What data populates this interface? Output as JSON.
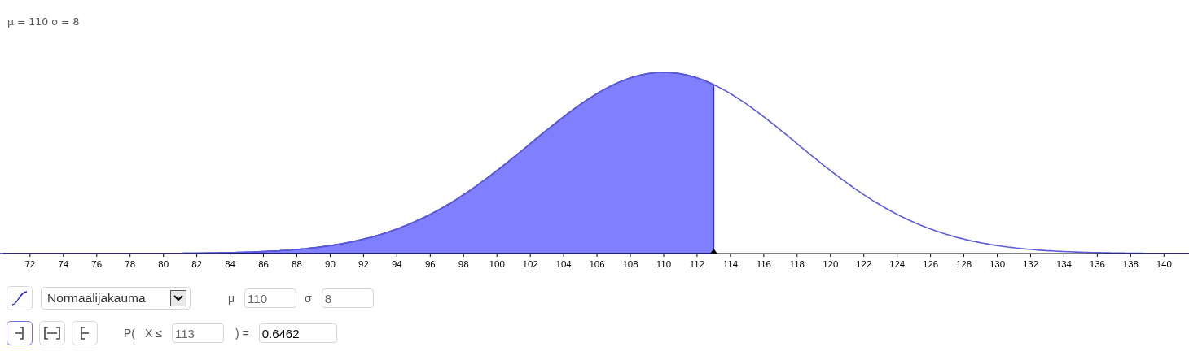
{
  "caption": "μ = 110 σ = 8",
  "axis_labels": [
    "72",
    "74",
    "76",
    "78",
    "80",
    "82",
    "84",
    "86",
    "88",
    "90",
    "92",
    "94",
    "96",
    "98",
    "100",
    "102",
    "104",
    "106",
    "108",
    "110",
    "112",
    "114",
    "116",
    "118",
    "120",
    "122",
    "124",
    "126",
    "128",
    "130",
    "132",
    "134",
    "136",
    "138",
    "140"
  ],
  "distribution": {
    "value": "Normaalijakauma"
  },
  "parameters": [
    {
      "label": "μ",
      "value": "110"
    },
    {
      "label": "σ",
      "value": "8"
    }
  ],
  "interval_buttons": [
    {
      "kind": "left",
      "selected": true
    },
    {
      "kind": "two",
      "selected": false
    },
    {
      "kind": "right",
      "selected": false
    }
  ],
  "probability": {
    "prefix": "P(",
    "condition": "X ≤",
    "bound": "113",
    "equals": ") =",
    "result": "0.6462"
  }
}
